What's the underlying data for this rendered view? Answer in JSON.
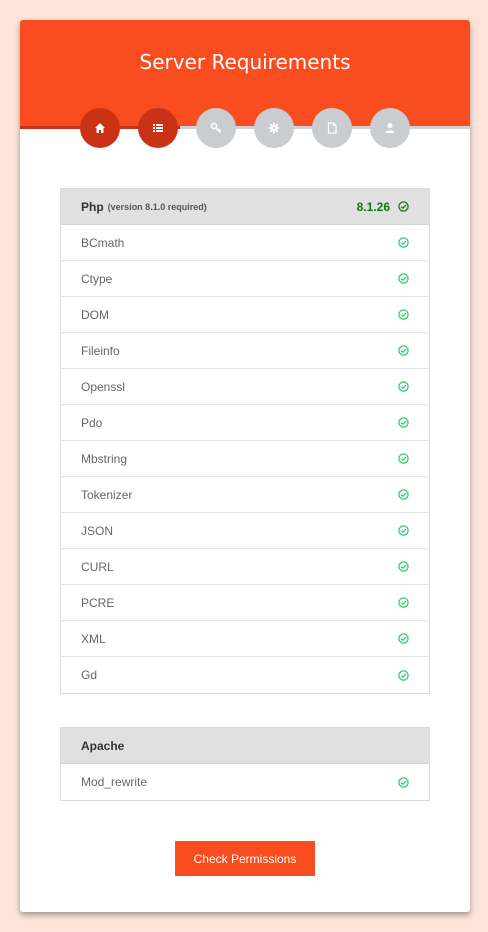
{
  "header": {
    "title": "Server Requirements"
  },
  "steps": [
    {
      "icon": "home-icon",
      "state": "done"
    },
    {
      "icon": "list-icon",
      "state": "done"
    },
    {
      "icon": "key-icon",
      "state": "todo"
    },
    {
      "icon": "gear-icon",
      "state": "todo"
    },
    {
      "icon": "file-icon",
      "state": "todo"
    },
    {
      "icon": "user-icon",
      "state": "todo"
    }
  ],
  "php": {
    "label": "Php",
    "sublabel": "(version 8.1.0 required)",
    "version": "8.1.26",
    "extensions": [
      "BCmath",
      "Ctype",
      "DOM",
      "Fileinfo",
      "Openssl",
      "Pdo",
      "Mbstring",
      "Tokenizer",
      "JSON",
      "CURL",
      "PCRE",
      "XML",
      "Gd"
    ]
  },
  "apache": {
    "label": "Apache",
    "modules": [
      "Mod_rewrite"
    ]
  },
  "actions": {
    "check_permissions": "Check Permissions"
  },
  "colors": {
    "accent": "#f94d20",
    "accent_dark": "#c93214",
    "step_inactive": "#c9cdd0",
    "check_ok": "#2ecc71",
    "version_ok": "#0c7a0c",
    "background": "#fde3d8"
  }
}
